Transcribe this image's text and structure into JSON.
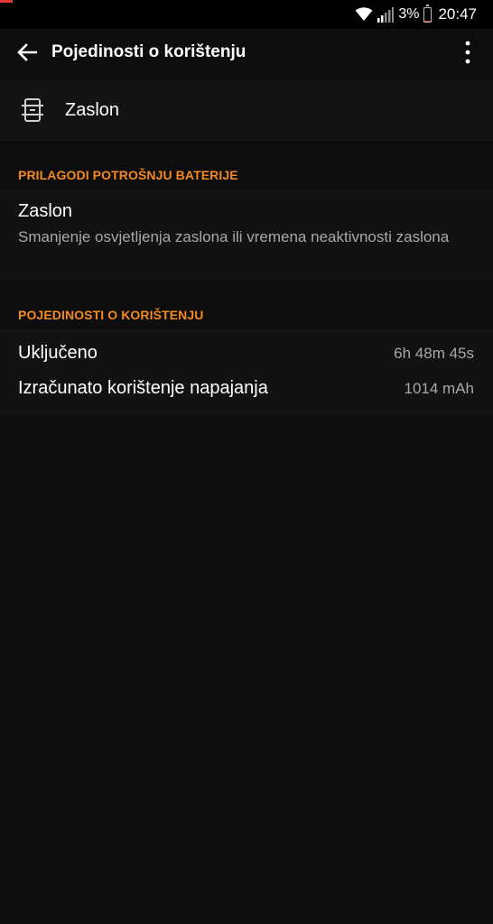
{
  "status_bar": {
    "battery_percent": "3%",
    "battery_level": 0.03,
    "time": "20:47",
    "icons": [
      "wifi-icon",
      "signal-icon",
      "battery-icon"
    ]
  },
  "toolbar": {
    "title": "Pojedinosti o korištenju",
    "back_icon": "arrow-back-icon",
    "overflow_icon": "more-vert-icon"
  },
  "app": {
    "name": "Zaslon",
    "icon": "screen-icon"
  },
  "sections": {
    "adjust": {
      "title": "PRILAGODI POTROŠNJU BATERIJE",
      "item_title": "Zaslon",
      "item_summary": "Smanjenje osvjetljenja zaslona ili vremena neaktivnosti zaslona"
    },
    "details": {
      "title": "POJEDINOSTI O KORIŠTENJU",
      "rows": [
        {
          "label": "Uključeno",
          "value": "6h 48m 45s"
        },
        {
          "label": "Izračunato korištenje napajanja",
          "value": "1014 mAh"
        }
      ]
    }
  },
  "colors": {
    "accent": "#f5891e",
    "background": "#0d0d0d",
    "surface": "#121212",
    "secondary_text": "#a8a8a8",
    "battery_low": "#e53935"
  }
}
